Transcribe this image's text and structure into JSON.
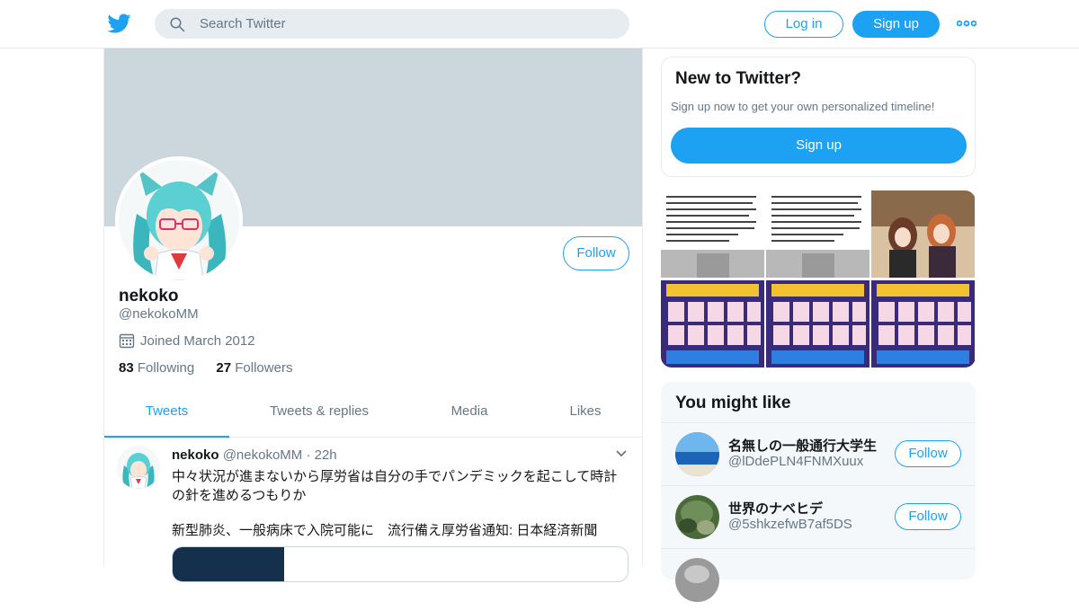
{
  "brand": {
    "accent": "#1da1f2",
    "icon": "twitter-bird-icon"
  },
  "header": {
    "search_placeholder": "Search Twitter",
    "login_label": "Log in",
    "signup_label": "Sign up",
    "more_icon": "more-dots-icon"
  },
  "profile": {
    "name": "nekoko",
    "handle": "@nekokoMM",
    "joined": "Joined March 2012",
    "following_count": "83",
    "following_label": "Following",
    "followers_count": "27",
    "followers_label": "Followers",
    "follow_label": "Follow"
  },
  "tabs": [
    {
      "label": "Tweets",
      "active": true
    },
    {
      "label": "Tweets & replies",
      "active": false
    },
    {
      "label": "Media",
      "active": false
    },
    {
      "label": "Likes",
      "active": false
    }
  ],
  "tweet": {
    "name": "nekoko",
    "handle": "@nekokoMM",
    "separator": "·",
    "time": "22h",
    "line1": "中々状況が進まないから厚労省は自分の手でパンデミックを起こして時計の針を進めるつもりか",
    "line2": "新型肺炎、一般病床で入院可能に　流行備え厚労省通知: 日本経済新聞"
  },
  "signup_box": {
    "title": "New to Twitter?",
    "subtitle": "Sign up now to get your own personalized timeline!",
    "button": "Sign up"
  },
  "you_might_like": {
    "title": "You might like",
    "follow_label": "Follow",
    "users": [
      {
        "name": "名無しの一般通行大学生",
        "handle": "@lDdePLN4FNMXuux"
      },
      {
        "name": "世界のナベヒデ",
        "handle": "@5shkzefwB7af5DS"
      }
    ]
  }
}
